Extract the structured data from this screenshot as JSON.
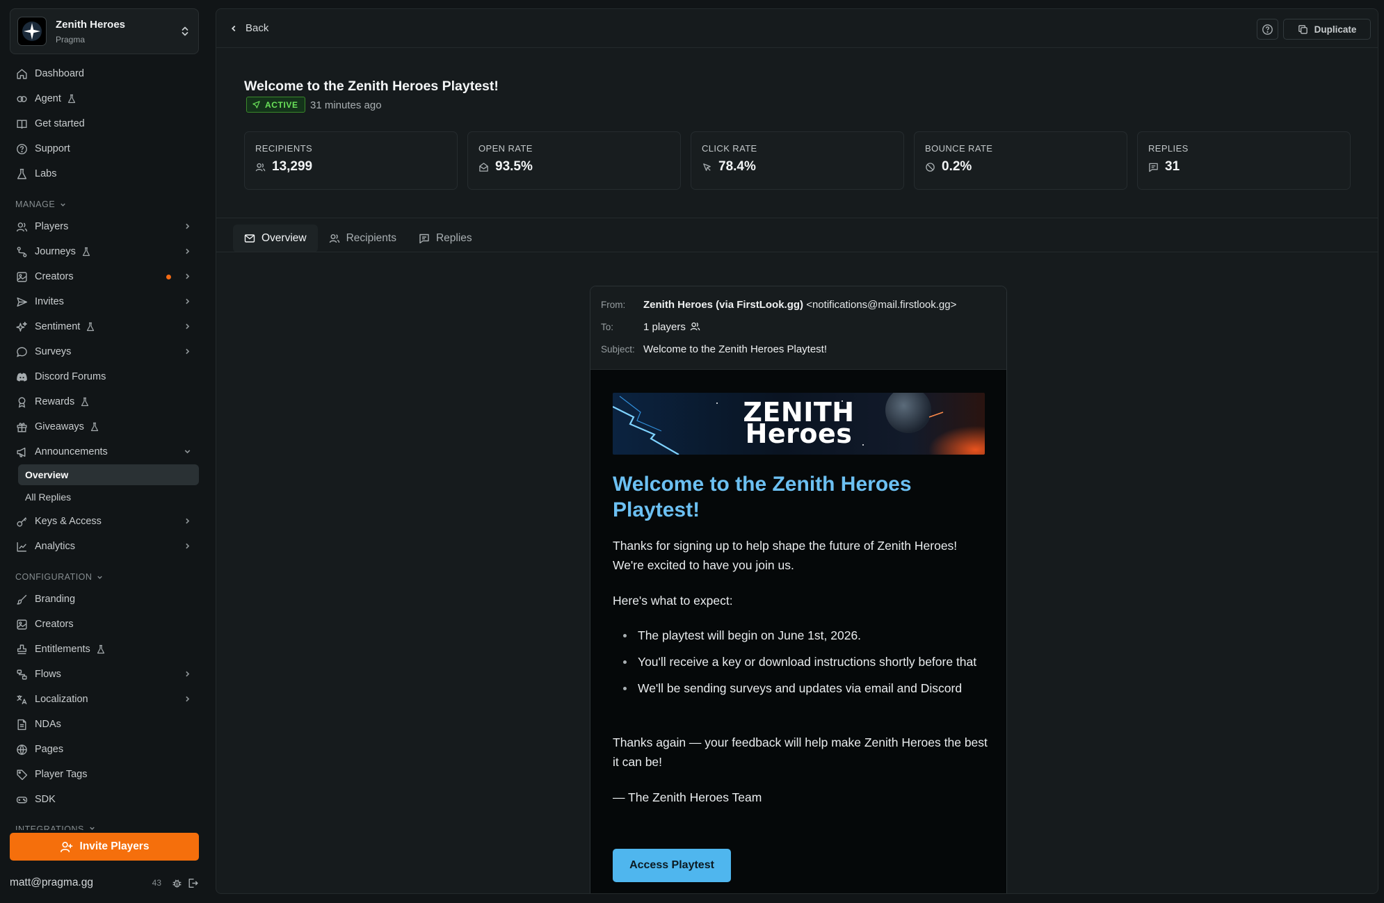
{
  "workspace": {
    "name": "Zenith Heroes",
    "org": "Pragma"
  },
  "nav": {
    "dashboard": "Dashboard",
    "agent": "Agent",
    "get_started": "Get started",
    "support": "Support",
    "labs": "Labs",
    "manage_label": "MANAGE",
    "players": "Players",
    "journeys": "Journeys",
    "creators": "Creators",
    "invites": "Invites",
    "sentiment": "Sentiment",
    "surveys": "Surveys",
    "discord_forums": "Discord Forums",
    "rewards": "Rewards",
    "giveaways": "Giveaways",
    "announcements": "Announcements",
    "announcements_overview": "Overview",
    "announcements_all_replies": "All Replies",
    "keys_access": "Keys & Access",
    "analytics": "Analytics",
    "configuration_label": "CONFIGURATION",
    "branding": "Branding",
    "config_creators": "Creators",
    "entitlements": "Entitlements",
    "flows": "Flows",
    "localization": "Localization",
    "ndas": "NDAs",
    "pages": "Pages",
    "player_tags": "Player Tags",
    "sdk": "SDK",
    "integrations_label": "INTEGRATIONS"
  },
  "invite_button": "Invite Players",
  "user": {
    "email": "matt@pragma.gg",
    "count": "43"
  },
  "topbar": {
    "back": "Back",
    "duplicate": "Duplicate"
  },
  "announcement": {
    "title": "Welcome to the Zenith Heroes Playtest!",
    "status": "ACTIVE",
    "time_ago": "31 minutes ago"
  },
  "stats": [
    {
      "label": "RECIPIENTS",
      "value": "13,299",
      "icon": "users-icon"
    },
    {
      "label": "OPEN RATE",
      "value": "93.5%",
      "icon": "mail-open-icon"
    },
    {
      "label": "CLICK RATE",
      "value": "78.4%",
      "icon": "cursor-icon"
    },
    {
      "label": "BOUNCE RATE",
      "value": "0.2%",
      "icon": "ban-icon"
    },
    {
      "label": "REPLIES",
      "value": "31",
      "icon": "message-icon"
    }
  ],
  "tabs": {
    "overview": "Overview",
    "recipients": "Recipients",
    "replies": "Replies"
  },
  "email": {
    "from_label": "From:",
    "from_name": "Zenith Heroes (via FirstLook.gg)",
    "from_address": "<notifications@mail.firstlook.gg>",
    "to_label": "To:",
    "to_value": "1 players",
    "subject_label": "Subject:",
    "subject": "Welcome to the Zenith Heroes Playtest!",
    "banner_line1": "ZENITH",
    "banner_line2": "Heroes",
    "heading": "Welcome to the Zenith Heroes Playtest!",
    "intro": "Thanks for signing up to help shape the future of Zenith Heroes! We're excited to have you join us.",
    "expect": "Here's what to expect:",
    "bullets": [
      "The playtest will begin on June 1st, 2026.",
      "You'll receive a key or download instructions shortly before that",
      "We'll be sending surveys and updates via email and Discord"
    ],
    "closing": "Thanks again — your feedback will help make Zenith Heroes the best it can be!",
    "signoff": "— The Zenith Heroes Team",
    "cta": "Access Playtest"
  },
  "colors": {
    "accent": "#f56f0c",
    "active_badge": "#6ae35a",
    "email_heading": "#6cc0f2",
    "cta": "#4fb6ee"
  }
}
